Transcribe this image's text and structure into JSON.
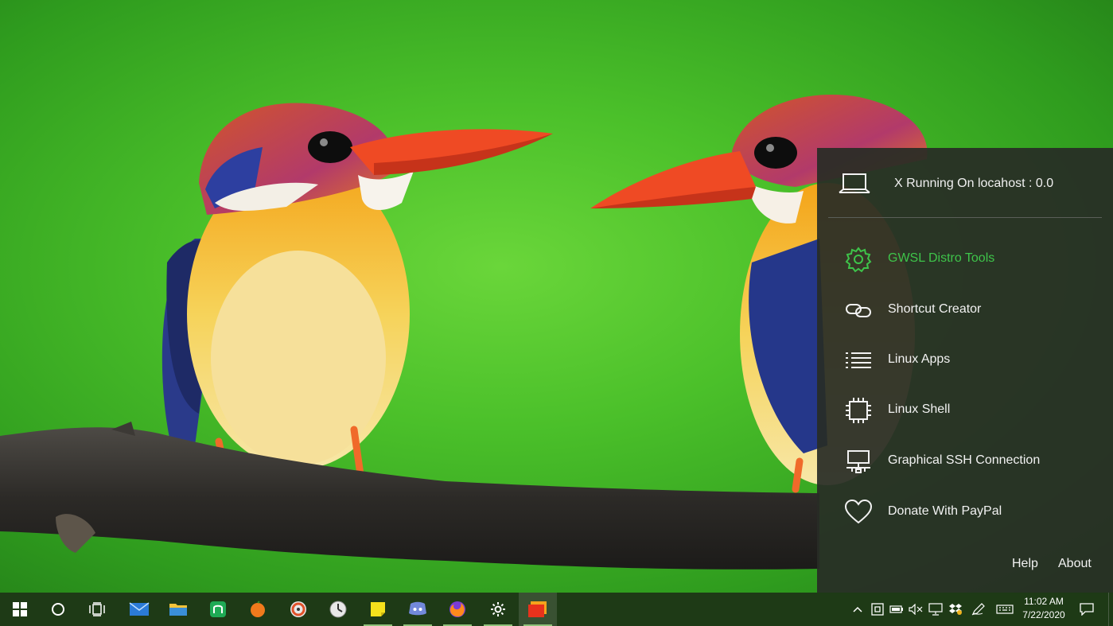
{
  "panel": {
    "status_text": "X Running On locahost : 0.0",
    "menu": [
      {
        "label": "GWSL Distro Tools",
        "icon": "gear-icon",
        "active": true
      },
      {
        "label": "Shortcut Creator",
        "icon": "link-icon",
        "active": false
      },
      {
        "label": "Linux Apps",
        "icon": "list-icon",
        "active": false
      },
      {
        "label": "Linux Shell",
        "icon": "chip-icon",
        "active": false
      },
      {
        "label": "Graphical SSH Connection",
        "icon": "network-monitor-icon",
        "active": false
      },
      {
        "label": "Donate With PayPal",
        "icon": "heart-icon",
        "active": false
      }
    ],
    "help_label": "Help",
    "about_label": "About",
    "accent_color": "#3ec44a"
  },
  "taskbar": {
    "apps": [
      "start-icon",
      "search-circle-icon",
      "task-view-icon",
      "mail-icon",
      "file-explorer-icon",
      "store-green-icon",
      "fruit-app-icon",
      "media-ring-icon",
      "clock-app-icon",
      "sticky-notes-icon",
      "discord-icon",
      "firefox-icon",
      "settings-icon",
      "gwsl-icon"
    ],
    "tray": [
      "chevron-up-icon",
      "gwsl-tray-icon",
      "battery-icon",
      "volume-muted-icon",
      "network-icon",
      "dropbox-icon",
      "pen-icon",
      "keyboard-icon"
    ],
    "time": "11:02 AM",
    "date": "7/22/2020"
  }
}
